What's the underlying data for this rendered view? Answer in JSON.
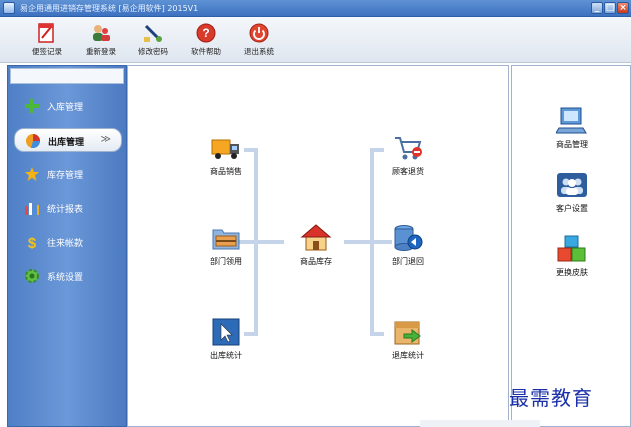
{
  "window": {
    "title": "易企用通用进销存管理系统 [易企用软件] 2015V1",
    "buttons": {
      "minimize": "_",
      "maximize": "□",
      "close": "×"
    }
  },
  "toolbar": {
    "items": [
      {
        "label": "便签记录",
        "icon": "notepad-icon"
      },
      {
        "label": "重新登录",
        "icon": "relogin-icon"
      },
      {
        "label": "修改密码",
        "icon": "password-icon"
      },
      {
        "label": "软件帮助",
        "icon": "help-icon"
      },
      {
        "label": "退出系统",
        "icon": "power-icon"
      }
    ]
  },
  "sidebar": {
    "items": [
      {
        "label": "入库管理",
        "icon": "plus-icon"
      },
      {
        "label": "出库管理",
        "icon": "pie-icon",
        "active": true,
        "chevron": "≫"
      },
      {
        "label": "库存管理",
        "icon": "star-icon"
      },
      {
        "label": "统计报表",
        "icon": "bar-chart-icon"
      },
      {
        "label": "往来帐款",
        "icon": "dollar-icon"
      },
      {
        "label": "系统设置",
        "icon": "gear-icon"
      }
    ]
  },
  "flow": {
    "left": [
      {
        "label": "商品销售",
        "icon": "truck-icon"
      },
      {
        "label": "部门领用",
        "icon": "folder-icon"
      },
      {
        "label": "出库统计",
        "icon": "cursor-icon"
      }
    ],
    "center": {
      "label": "商品库存",
      "icon": "house-icon"
    },
    "right": [
      {
        "label": "顾客退货",
        "icon": "cart-icon"
      },
      {
        "label": "部门退回",
        "icon": "database-icon"
      },
      {
        "label": "退库统计",
        "icon": "box-arrow-icon"
      }
    ]
  },
  "right_panel": {
    "items": [
      {
        "label": "商品管理",
        "icon": "computer-icon"
      },
      {
        "label": "客户设置",
        "icon": "people-icon"
      },
      {
        "label": "更换皮肤",
        "icon": "cubes-icon"
      }
    ]
  },
  "watermark": "最需教育",
  "colors": {
    "titlebar": "#4a7fcb",
    "sidebar": "#5a88cf",
    "flow_line": "#c6d4ea",
    "watermark": "#1a2fa8"
  }
}
